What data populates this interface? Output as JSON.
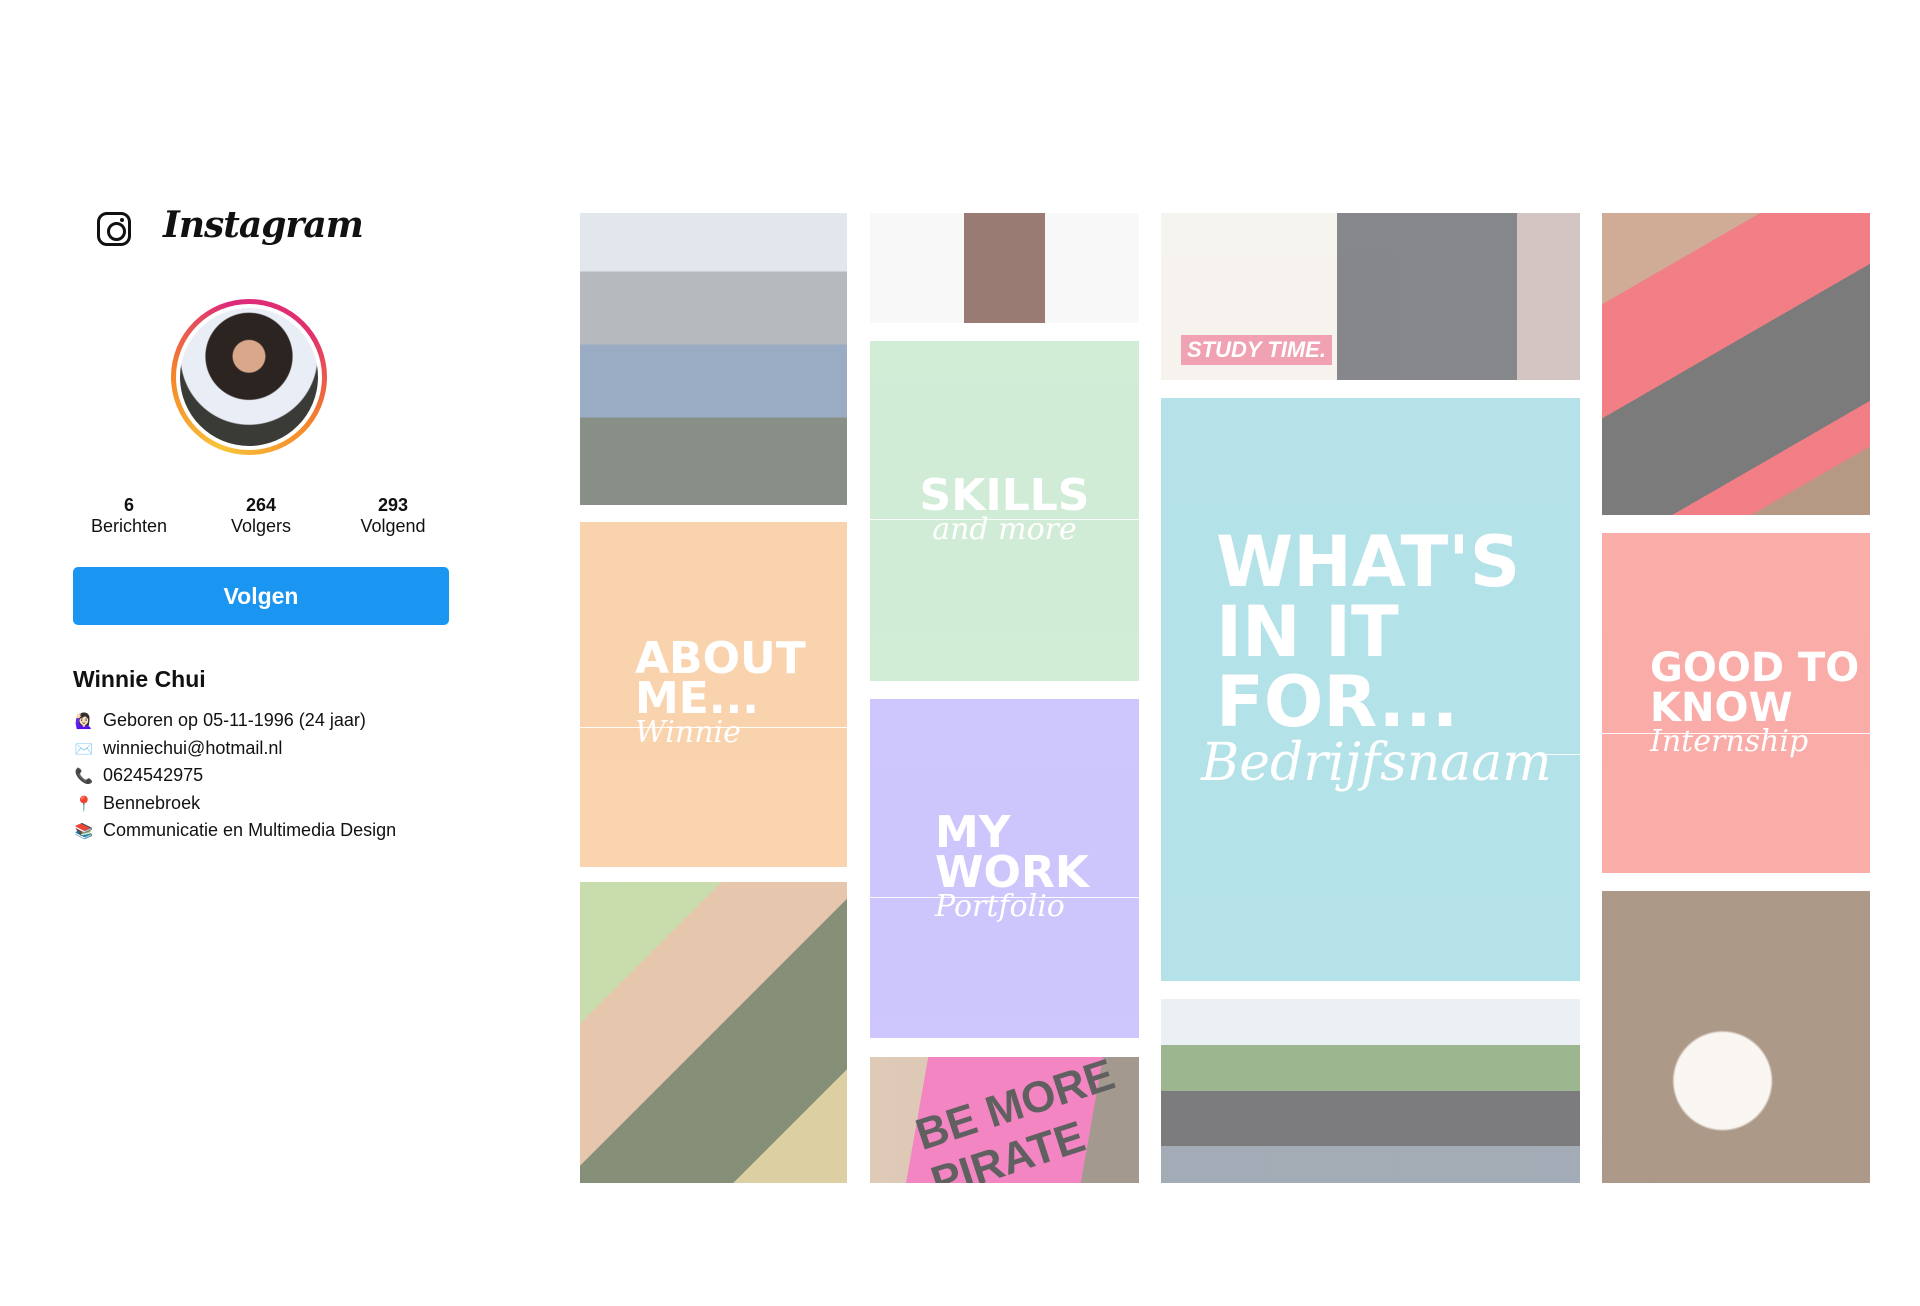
{
  "header": {
    "app_name": "Instagram",
    "logo_icon": "instagram-icon"
  },
  "profile": {
    "stats": [
      {
        "value": "6",
        "label": "Berichten"
      },
      {
        "value": "264",
        "label": "Volgers"
      },
      {
        "value": "293",
        "label": "Volgend"
      }
    ],
    "follow_label": "Volgen",
    "name": "Winnie Chui",
    "info": [
      {
        "icon": "🙋🏻‍♀️",
        "text": "Geboren op 05-11-1996 (24 jaar)"
      },
      {
        "icon": "✉️",
        "text": "winniechui@hotmail.nl"
      },
      {
        "icon": "📞",
        "text": "0624542975"
      },
      {
        "icon": "📍",
        "text": "Bennebroek"
      },
      {
        "icon": "📚",
        "text": "Communicatie en Multimedia Design"
      }
    ]
  },
  "grid": {
    "about": {
      "title": "ABOUT ME...",
      "subtitle": "Winnie"
    },
    "skills": {
      "title": "SKILLS",
      "subtitle": "and more"
    },
    "work": {
      "title": "MY WORK",
      "subtitle": "Portfolio"
    },
    "whats": {
      "title": "WHAT'S IN IT FOR...",
      "subtitle": "Bedrijfsnaam"
    },
    "good": {
      "title": "GOOD TO KNOW",
      "subtitle": "Internship"
    },
    "study_label": "STUDY TIME.",
    "pirate_label": "BE MORE PIRATE",
    "colors": {
      "about": "#f6b97d",
      "skills": "#b6e2bd",
      "work": "#b0a4fb",
      "whats": "#87d1dc",
      "good": "#f77b74"
    }
  }
}
